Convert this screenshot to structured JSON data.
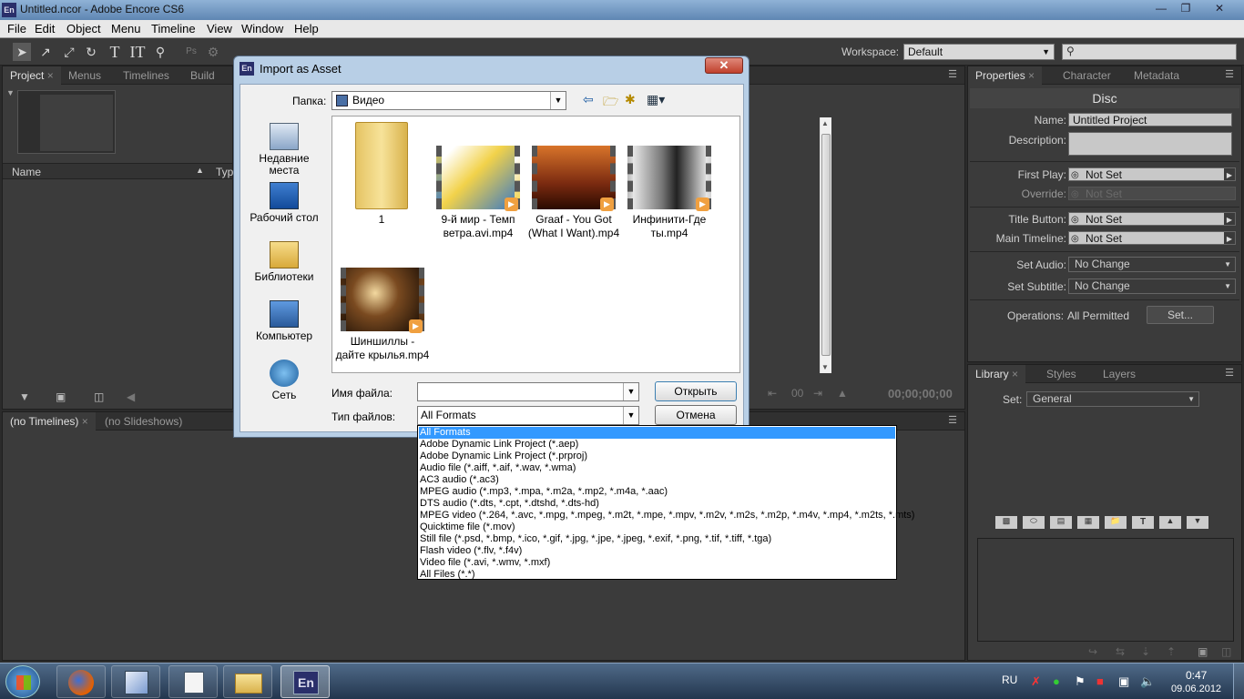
{
  "app": {
    "title": "Untitled.ncor - Adobe Encore CS6",
    "logo": "En"
  },
  "menubar": [
    "File",
    "Edit",
    "Object",
    "Menu",
    "Timeline",
    "View",
    "Window",
    "Help"
  ],
  "toolbar": {
    "workspace_label": "Workspace:",
    "workspace_value": "Default"
  },
  "project_panel": {
    "tabs": [
      "Project",
      "Menus",
      "Timelines",
      "Build"
    ],
    "col_name": "Name",
    "col_type": "Typ"
  },
  "timeline_panel": {
    "tabs": [
      "(no Timelines)",
      "(no Slideshows)"
    ],
    "timecode": "00;00;00;00",
    "frames": "00"
  },
  "properties_panel": {
    "tabs": [
      "Properties",
      "Character",
      "Metadata"
    ],
    "heading": "Disc",
    "name_label": "Name:",
    "name_value": "Untitled Project",
    "description_label": "Description:",
    "first_play_label": "First Play:",
    "first_play_value": "Not Set",
    "override_label": "Override:",
    "override_value": "Not Set",
    "title_button_label": "Title Button:",
    "title_button_value": "Not Set",
    "main_timeline_label": "Main Timeline:",
    "main_timeline_value": "Not Set",
    "set_audio_label": "Set Audio:",
    "set_audio_value": "No Change",
    "set_subtitle_label": "Set Subtitle:",
    "set_subtitle_value": "No Change",
    "operations_label": "Operations:",
    "operations_value": "All Permitted",
    "set_button": "Set..."
  },
  "library_panel": {
    "tabs": [
      "Library",
      "Styles",
      "Layers"
    ],
    "set_label": "Set:",
    "set_value": "General"
  },
  "dialog": {
    "title": "Import as Asset",
    "folder_label": "Папка:",
    "folder_value": "Видео",
    "places": [
      "Недавние места",
      "Рабочий стол",
      "Библиотеки",
      "Компьютер",
      "Сеть"
    ],
    "files": [
      {
        "name": "1"
      },
      {
        "name": "9-й мир - Темп ветра.avi.mp4"
      },
      {
        "name": "Graaf - You Got (What I Want).mp4"
      },
      {
        "name": "Инфинити-Где ты.mp4"
      },
      {
        "name": "Шиншиллы - дайте крылья.mp4"
      }
    ],
    "filename_label": "Имя файла:",
    "filename_value": "",
    "filetype_label": "Тип файлов:",
    "filetype_value": "All Formats",
    "open_button": "Открыть",
    "cancel_button": "Отмена"
  },
  "filetype_options": [
    "All Formats",
    "Adobe Dynamic Link Project (*.aep)",
    "Adobe Dynamic Link Project (*.prproj)",
    "Audio file (*.aiff, *.aif, *.wav, *.wma)",
    "AC3 audio (*.ac3)",
    "MPEG audio (*.mp3, *.mpa, *.m2a, *.mp2, *.m4a, *.aac)",
    "DTS audio (*.dts, *.cpt, *.dtshd, *.dts-hd)",
    "MPEG video (*.264, *.avc, *.mpg, *.mpeg, *.m2t, *.mpe, *.mpv, *.m2v, *.m2s, *.m2p, *.m4v, *.mp4, *.m2ts, *.mts)",
    "Quicktime file (*.mov)",
    "Still file (*.psd, *.bmp, *.ico, *.gif, *.jpg, *.jpe, *.jpeg, *.exif, *.png, *.tif, *.tiff, *.tga)",
    "Flash video (*.flv, *.f4v)",
    "Video file (*.avi, *.wmv, *.mxf)",
    "All Files (*.*)"
  ],
  "taskbar": {
    "lang": "RU",
    "time": "0:47",
    "date": "09.06.2012",
    "active_app": "En"
  }
}
